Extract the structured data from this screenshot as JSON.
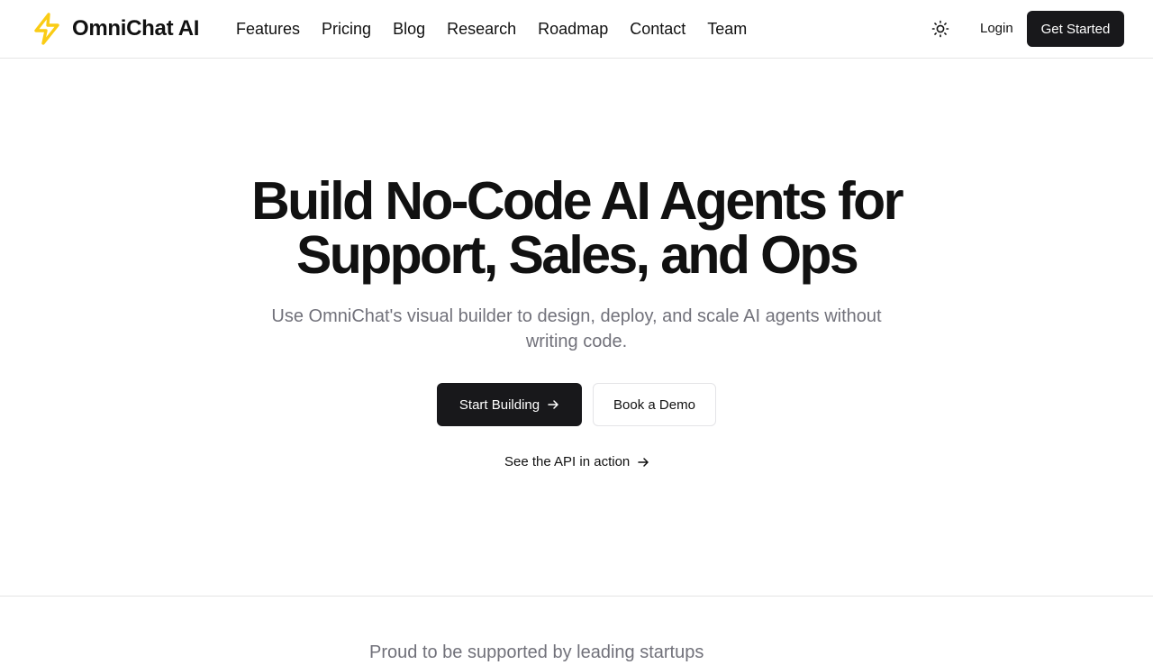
{
  "brand": {
    "name": "OmniChat AI",
    "accent_color": "#FACC15"
  },
  "nav": {
    "items": [
      "Features",
      "Pricing",
      "Blog",
      "Research",
      "Roadmap",
      "Contact",
      "Team"
    ]
  },
  "header": {
    "theme_toggle_icon": "sun-icon",
    "login_label": "Login",
    "get_started_label": "Get Started"
  },
  "hero": {
    "title_line1": "Build No-Code AI Agents for",
    "title_line2": "Support, Sales, and Ops",
    "subtitle": "Use OmniChat's visual builder to design, deploy, and scale AI agents without writing code.",
    "primary_cta": "Start Building",
    "secondary_cta": "Book a Demo",
    "api_link": "See the API in action"
  },
  "trusted": {
    "text": "Proud to be supported by leading startups"
  },
  "colors": {
    "primary_button": "#18181b",
    "muted_text": "#71717a",
    "border": "#e5e5e5"
  }
}
